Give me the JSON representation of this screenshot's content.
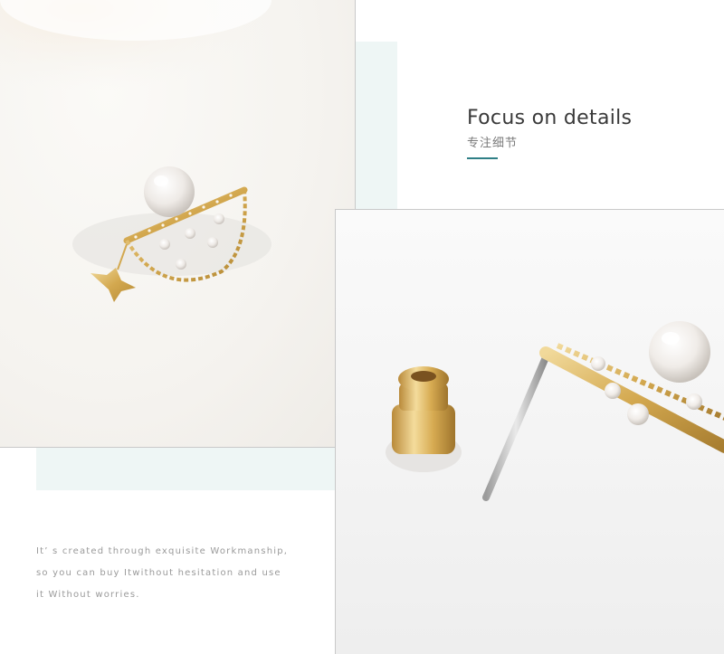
{
  "heading": {
    "title": "Focus on details",
    "subtitle": "专注细节"
  },
  "caption": {
    "line1": "It’ s created through exquisite Workmanship,",
    "line2": "so you can buy Itwithout hesitation and use",
    "line3": "it Without worries."
  },
  "colors": {
    "accent_rule": "#2f7f86",
    "mint_band": "#eef6f5",
    "gold": "#d9b25a",
    "pearl": "#f3f0ec"
  },
  "images": {
    "left_photo": "pearl-earring-front-photo",
    "right_photo": "earring-back-and-pin-photo"
  }
}
